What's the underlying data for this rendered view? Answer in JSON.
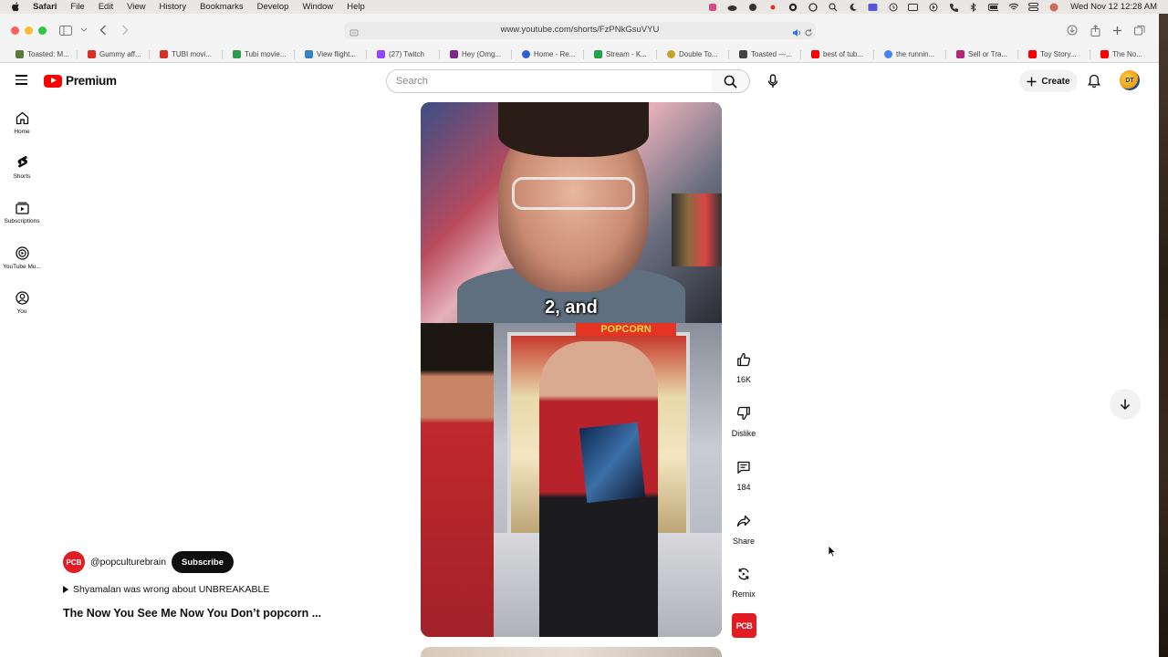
{
  "menubar": {
    "app": "Safari",
    "items": [
      "File",
      "Edit",
      "View",
      "History",
      "Bookmarks",
      "Develop",
      "Window",
      "Help"
    ],
    "clock": "Wed Nov 12  12:28 AM"
  },
  "browser": {
    "url": "www.youtube.com/shorts/FzPNkGsuVYU",
    "favorites": [
      "Toasted: M...",
      "Gummy aff...",
      "TUBI movi...",
      "Tubi movie...",
      "View flight...",
      "(27) Twitch",
      "Hey (Omg...",
      "Home - Re...",
      "Stream - K...",
      "Double To...",
      "Toasted —...",
      "best of tub...",
      "the runnin...",
      "Sell or Tra...",
      "Toy Story...",
      "The No..."
    ]
  },
  "youtube": {
    "logo_text": "Premium",
    "search_placeholder": "Search",
    "create_label": "Create",
    "avatar_initials": "DT",
    "nav": [
      {
        "label": "Home"
      },
      {
        "label": "Shorts"
      },
      {
        "label": "Subscriptions"
      },
      {
        "label": "YouTube Mu..."
      },
      {
        "label": "You"
      }
    ],
    "video": {
      "caption": "2, and",
      "sign_text": "POPCORN"
    },
    "actions": {
      "likes": "16K",
      "dislike": "Dislike",
      "comments": "184",
      "share": "Share",
      "remix": "Remix"
    },
    "channel": {
      "handle": "@popculturebrain",
      "avatar_text": "PCB",
      "subscribe_label": "Subscribe"
    },
    "related_link": "Shyamalan was wrong about UNBREAKABLE",
    "title": "The Now You See Me Now You Don’t popcorn ..."
  },
  "colors": {
    "brand_red": "#ff0000",
    "channel_red": "#e31b23"
  }
}
